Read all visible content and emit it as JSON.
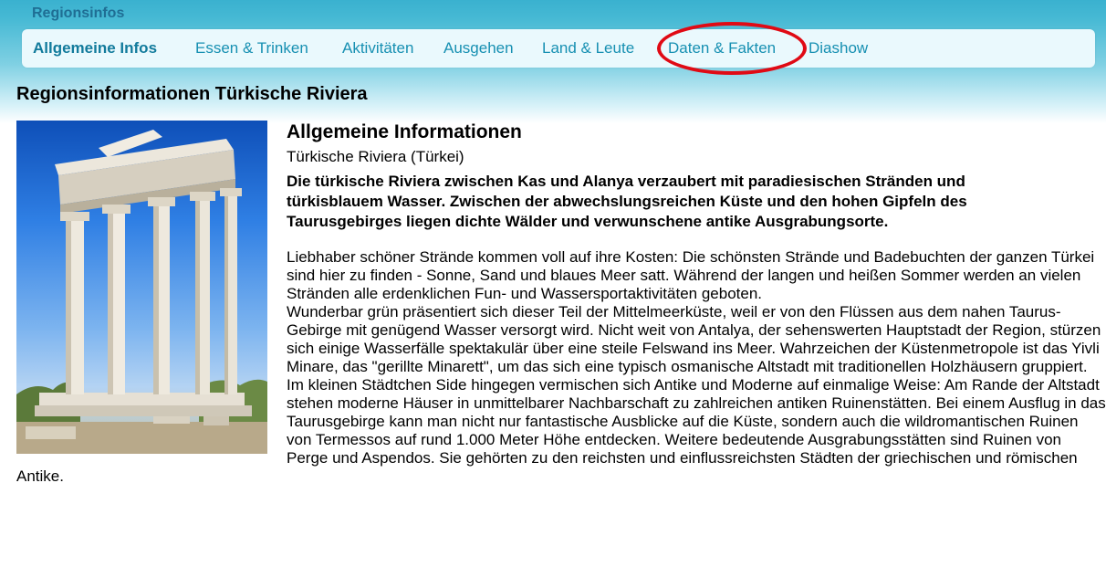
{
  "section_label": "Regionsinfos",
  "nav": {
    "items": [
      {
        "label": "Allgemeine Infos",
        "active": true
      },
      {
        "label": "Essen & Trinken",
        "active": false
      },
      {
        "label": "Aktivitäten",
        "active": false
      },
      {
        "label": "Ausgehen",
        "active": false
      },
      {
        "label": "Land & Leute",
        "active": false
      },
      {
        "label": "Daten & Fakten",
        "active": false,
        "highlighted": true
      },
      {
        "label": "Diashow",
        "active": false
      }
    ],
    "highlight_color": "#e00a14",
    "link_color": "#1790b2"
  },
  "page_title": "Regionsinformationen Türkische Riviera",
  "info": {
    "heading": "Allgemeine Informationen",
    "subtitle": "Türkische Riviera (Türkei)",
    "lead": "Die türkische Riviera zwischen Kas und Alanya verzaubert mit paradiesischen Stränden und türkisblauem Wasser. Zwischen der abwechslungsreichen Küste und den hohen Gipfeln des Taurusgebirges liegen dichte Wälder und verwunschene antike Ausgrabungsorte.",
    "paragraphs": [
      "Liebhaber schöner Strände kommen voll auf ihre Kosten: Die schönsten Strände und Badebuchten der ganzen Türkei sind hier zu finden - Sonne, Sand und blaues Meer satt. Während der langen und heißen Sommer werden an vielen Stränden alle erdenklichen Fun- und Wassersportaktivitäten geboten.",
      "Wunderbar grün präsentiert sich dieser Teil der Mittelmeerküste, weil er von den Flüssen aus dem nahen Taurus-Gebirge mit genügend Wasser versorgt wird. Nicht weit von Antalya, der sehenswerten Hauptstadt der Region, stürzen sich einige Wasserfälle spektakulär über eine steile Felswand ins Meer. Wahrzeichen der Küstenmetropole ist das Yivli Minare, das \"gerillte Minarett\", um das sich eine typisch osmanische Altstadt mit traditionellen Holzhäusern gruppiert.",
      "Im kleinen Städtchen Side hingegen vermischen sich Antike und Moderne auf einmalige Weise: Am Rande der Altstadt stehen moderne Häuser in unmittelbarer Nachbarschaft zu zahlreichen antiken Ruinenstätten. Bei einem Ausflug in das Taurusgebirge kann man nicht nur fantastische Ausblicke auf die Küste, sondern auch die wildromantischen Ruinen von Termessos auf rund 1.000 Meter Höhe entdecken. Weitere bedeutende Ausgrabungsstätten sind Ruinen von Perge und Aspendos. Sie gehörten zu den reichsten und einflussreichsten Städten der griechischen und römischen Antike."
    ]
  }
}
